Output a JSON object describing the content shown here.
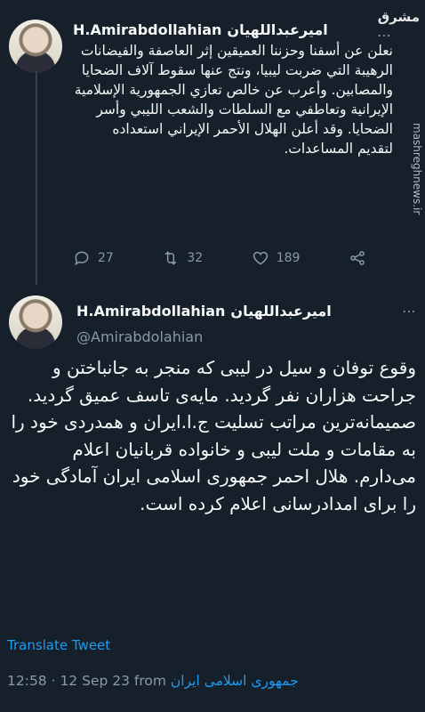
{
  "watermark": {
    "logo_text": "مشرق",
    "side_text": "mashreghnews.ir"
  },
  "tweet1": {
    "name_fa": "اميرعبداللهيان",
    "name_en": "H.Amirabdollahian",
    "text": "نعلن عن أسفنا وحزننا العميقين إثر العاصفة والفيضانات الرهيبة التي ضربت ليبيا، ونتج عنها سقوط آلاف الضحايا والمصابين. وأعرب عن خالص تعازي الجمهورية الإسلامية الإيرانية وتعاطفي مع السلطات والشعب الليبي وأسر الضحايا. وقد أعلن الهلال الأحمر الإيراني استعداده لتقديم المساعدات.",
    "replies": "27",
    "retweets": "32",
    "likes": "189"
  },
  "tweet2": {
    "name_fa": "اميرعبداللهيان",
    "name_en": "H.Amirabdollahian",
    "handle": "@Amirabdolahian",
    "text": "وقوع توفان و سیل در لیبی که منجر به جانباختن و جراحت هزاران نفر گردید. مایه‌ی تاسف عمیق گردید. صمیمانه‌ترین مراتب تسلیت ج.ا.ایران و همدردی خود را به مقامات و ملت لیبی و خانواده قربانیان اعلام می‌دارم. هلال احمر جمهوری اسلامی ایران آمادگی خود را برای امدادرسانی اعلام کرده است.",
    "translate_label": "Translate Tweet",
    "time": "12:58 · 12 Sep 23 from",
    "source": "جمهوری اسلامی ایران"
  },
  "colors": {
    "background": "#15202b",
    "link": "#1d9bf0",
    "muted": "#8b98a5"
  }
}
